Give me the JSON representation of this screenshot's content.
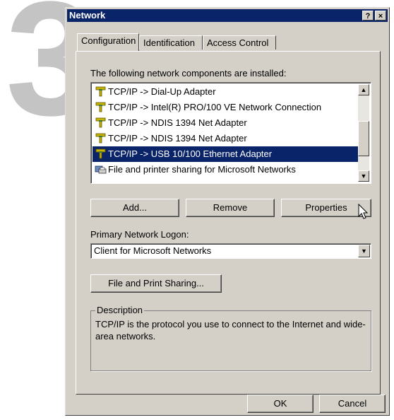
{
  "step_number": "3",
  "window": {
    "title": "Network",
    "help_button": "?",
    "close_button": "×"
  },
  "tabs": [
    {
      "label": "Configuration",
      "active": true
    },
    {
      "label": "Identification",
      "active": false
    },
    {
      "label": "Access Control",
      "active": false
    }
  ],
  "components_label": "The following network components are installed:",
  "components": [
    {
      "label": "TCP/IP -> Dial-Up Adapter",
      "icon": "network-protocol-icon",
      "selected": false
    },
    {
      "label": "TCP/IP -> Intel(R) PRO/100 VE Network Connection",
      "icon": "network-protocol-icon",
      "selected": false
    },
    {
      "label": "TCP/IP -> NDIS 1394 Net Adapter",
      "icon": "network-protocol-icon",
      "selected": false
    },
    {
      "label": "TCP/IP -> NDIS 1394 Net Adapter",
      "icon": "network-protocol-icon",
      "selected": false
    },
    {
      "label": "TCP/IP -> USB 10/100 Ethernet Adapter",
      "icon": "network-protocol-icon",
      "selected": true
    },
    {
      "label": "File and printer sharing for Microsoft Networks",
      "icon": "file-printer-sharing-icon",
      "selected": false
    }
  ],
  "buttons": {
    "add": "Add...",
    "remove": "Remove",
    "properties": "Properties",
    "file_print_sharing": "File and Print Sharing...",
    "ok": "OK",
    "cancel": "Cancel"
  },
  "primary_logon": {
    "label": "Primary Network Logon:",
    "value": "Client for Microsoft Networks"
  },
  "description": {
    "legend": "Description",
    "text": "TCP/IP is the protocol you use to connect to the Internet and wide-area networks."
  },
  "colors": {
    "title_bar": "#0a246a",
    "dialog_face": "#d4d0c8",
    "selection": "#0a246a",
    "step_number": "#c4c4c4"
  }
}
